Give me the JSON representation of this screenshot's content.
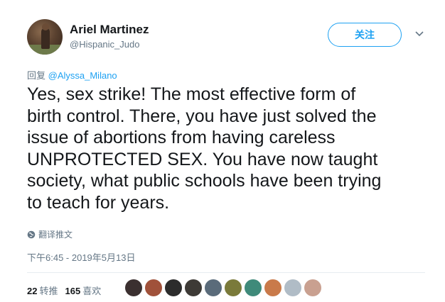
{
  "user": {
    "name": "Ariel Martinez",
    "handle": "@Hispanic_Judo"
  },
  "follow_label": "关注",
  "reply": {
    "prefix": "回复",
    "to": "@Alyssa_Milano"
  },
  "tweet_lines": [
    "Yes, sex strike! The most effective form of",
    "birth control. There, you have just solved the",
    "issue of abortions from having careless",
    "UNPROTECTED SEX. You have now taught",
    "society, what public schools have been trying",
    "to teach for years."
  ],
  "translate_label": "翻译推文",
  "timestamp": "下午6:45 - 2019年5月13日",
  "stats": {
    "retweets_count": "22",
    "retweets_label": "转推",
    "likes_count": "165",
    "likes_label": "喜欢"
  },
  "liker_avatar_colors": [
    "#3b3030",
    "#a0513a",
    "#2c2c2c",
    "#3d3a36",
    "#5a6b7a",
    "#7a7a3a",
    "#3f8a7a",
    "#c97a4a",
    "#b0bcc6",
    "#c9a090"
  ],
  "colors": {
    "accent": "#1da1f2",
    "muted": "#657786",
    "text": "#14171a"
  }
}
